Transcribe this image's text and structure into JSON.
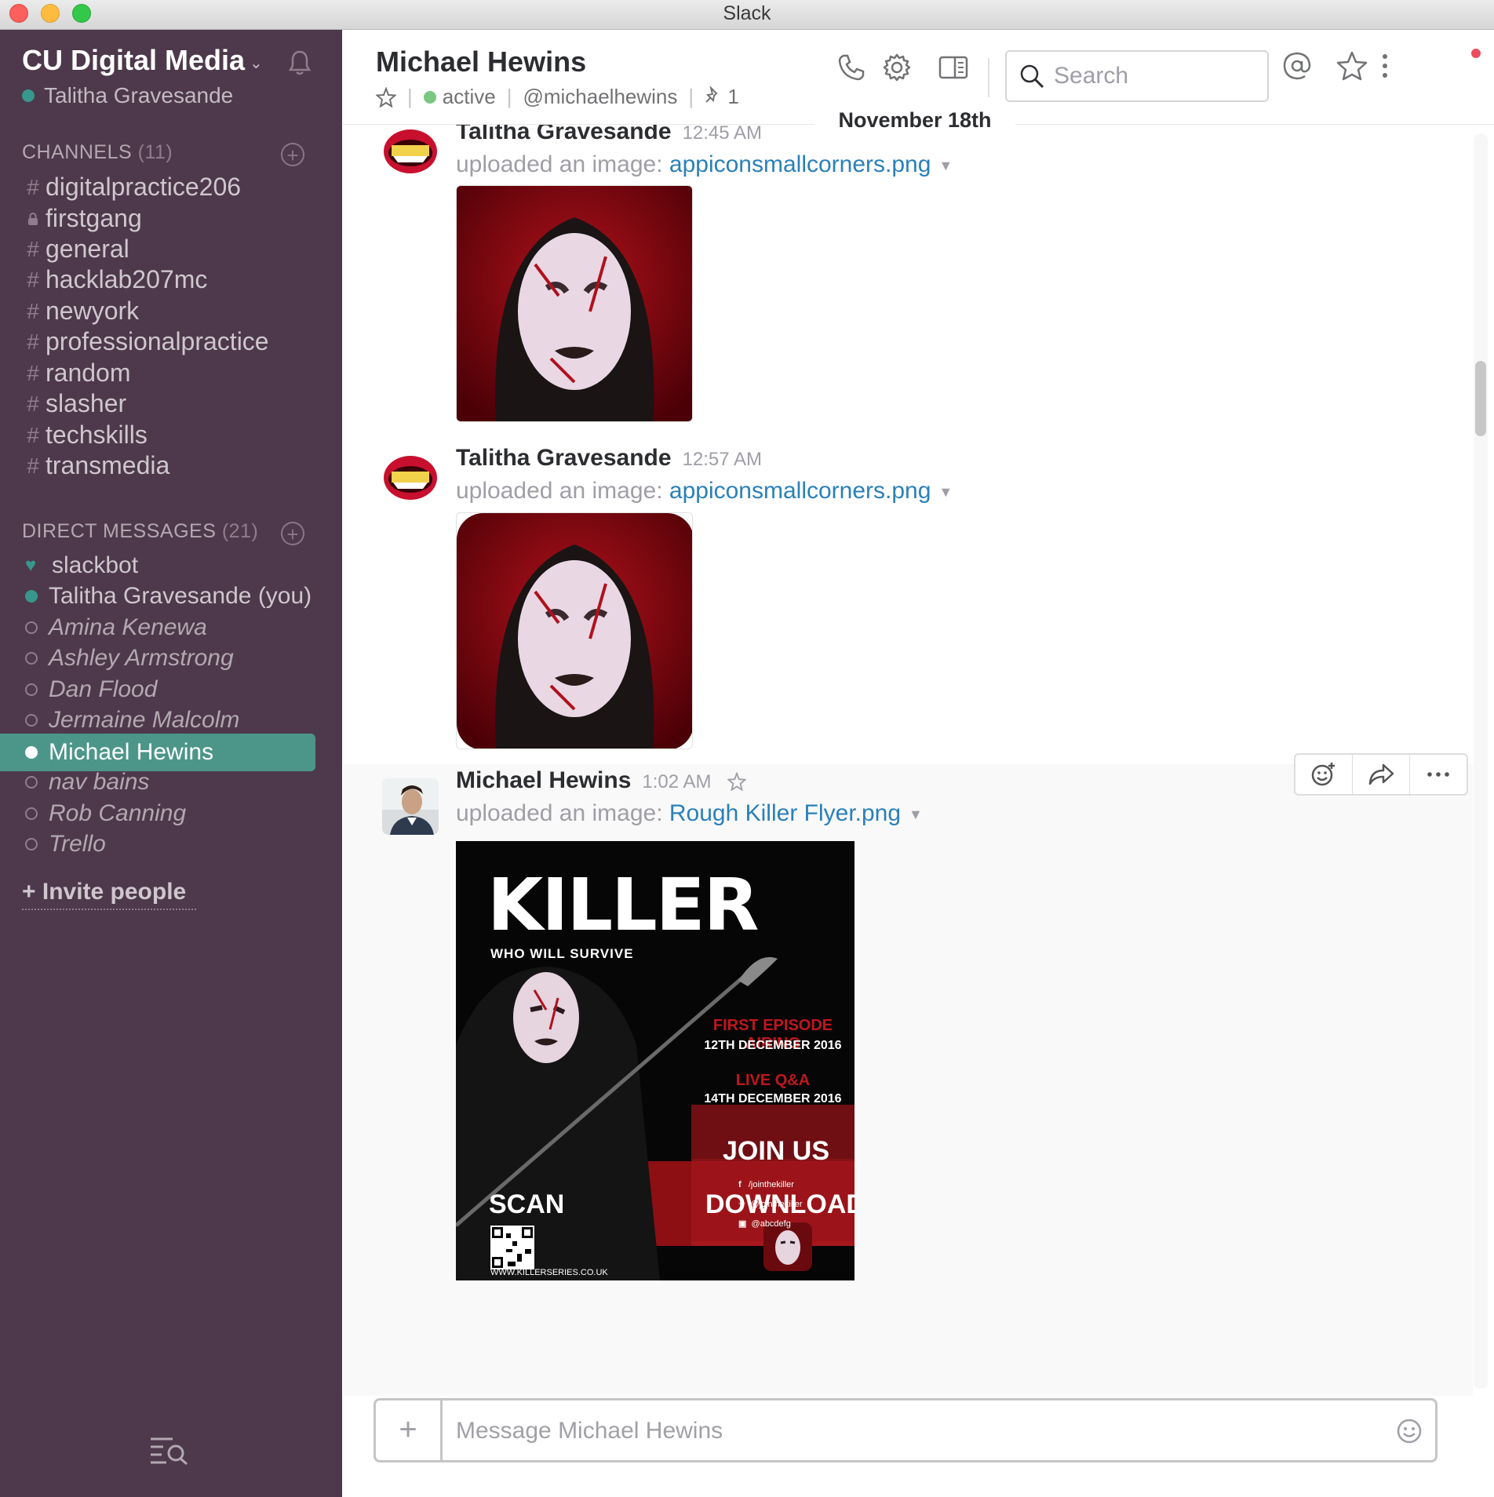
{
  "window": {
    "title": "Slack"
  },
  "sidebar": {
    "team_name": "CU Digital Media",
    "user_name": "Talitha Gravesande",
    "channels_label": "CHANNELS",
    "channels_count": "(11)",
    "channels": [
      {
        "prefix": "#",
        "name": "digitalpractice206"
      },
      {
        "prefix": "lock",
        "name": "firstgang"
      },
      {
        "prefix": "#",
        "name": "general"
      },
      {
        "prefix": "#",
        "name": "hacklab207mc"
      },
      {
        "prefix": "#",
        "name": "newyork"
      },
      {
        "prefix": "#",
        "name": "professionalpractice"
      },
      {
        "prefix": "#",
        "name": "random"
      },
      {
        "prefix": "#",
        "name": "slasher"
      },
      {
        "prefix": "#",
        "name": "techskills"
      },
      {
        "prefix": "#",
        "name": "transmedia"
      }
    ],
    "dm_label": "DIRECT MESSAGES",
    "dm_count": "(21)",
    "dms": [
      {
        "name": "slackbot",
        "status": "bot"
      },
      {
        "name": "Talitha Gravesande (you)",
        "status": "online"
      },
      {
        "name": "Amina Kenewa",
        "status": "away"
      },
      {
        "name": "Ashley Armstrong",
        "status": "away"
      },
      {
        "name": "Dan Flood",
        "status": "away"
      },
      {
        "name": "Jermaine Malcolm",
        "status": "away"
      },
      {
        "name": "Michael Hewins",
        "status": "selected"
      },
      {
        "name": "nav bains",
        "status": "away"
      },
      {
        "name": "Rob Canning",
        "status": "away"
      },
      {
        "name": "Trello",
        "status": "away"
      }
    ],
    "invite_label": "Invite people"
  },
  "header": {
    "title": "Michael Hewins",
    "presence": "active",
    "handle": "@michaelhewins",
    "pins": "1",
    "search_placeholder": "Search"
  },
  "date_divider": "November 18th",
  "messages": [
    {
      "sender": "Talitha Gravesande",
      "time": "12:45 AM",
      "text": "uploaded an image:",
      "file": "appiconsmallcorners.png"
    },
    {
      "sender": "Talitha Gravesande",
      "time": "12:57 AM",
      "text": "uploaded an image:",
      "file": "appiconsmallcorners.png"
    },
    {
      "sender": "Michael Hewins",
      "time": "1:02 AM",
      "text": "uploaded an image:",
      "file": "Rough Killer Flyer.png"
    }
  ],
  "flyer": {
    "title": "KILLER",
    "tagline": "WHO WILL SURVIVE",
    "airing_label": "FIRST EPISODE AIRING",
    "airing_date": "12TH DECEMBER 2016",
    "qa_label": "LIVE Q&A",
    "qa_date": "14TH DECEMBER 2016",
    "join": "JOIN US",
    "facebook": "/jointhekiller",
    "twitter": "@jointhekiller",
    "instagram": "@abcdefg",
    "scan": "SCAN",
    "download": "DOWNLOAD",
    "url": "WWW.KILLERSERIES.CO.UK"
  },
  "composer": {
    "placeholder": "Message Michael Hewins"
  },
  "colors": {
    "sidebar": "#4d394b",
    "selected": "#4c9689",
    "link": "#2a80b9",
    "accent_red": "#c0161d"
  }
}
